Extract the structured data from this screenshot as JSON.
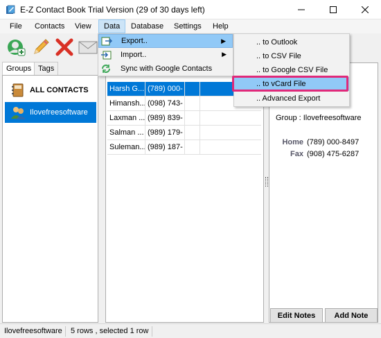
{
  "window": {
    "title": "E-Z Contact Book Trial Version (29 of 30 days left)"
  },
  "menubar": [
    "File",
    "Contacts",
    "View",
    "Data",
    "Database",
    "Settings",
    "Help"
  ],
  "left": {
    "tabs": [
      "Groups",
      "Tags"
    ],
    "groups": [
      "ALL CONTACTS",
      "Ilovefreesoftware"
    ]
  },
  "contacts": [
    {
      "name": "Harsh G...",
      "phone": "(789) 000-"
    },
    {
      "name": "Himansh...",
      "phone": "(098) 743-"
    },
    {
      "name": "Laxman ...",
      "phone": "(989) 839-"
    },
    {
      "name": "Salman ...",
      "phone": "(989) 179-"
    },
    {
      "name": "Suleman...",
      "phone": "(989) 187-"
    }
  ],
  "details": {
    "group_line": "Group : Ilovefreesoftware",
    "home_label": "Home",
    "home_value": "(789) 000-8497",
    "fax_label": "Fax",
    "fax_value": "(908) 475-6287",
    "edit_notes": "Edit Notes",
    "add_note": "Add Note"
  },
  "data_menu": [
    {
      "label": "Export..",
      "arrow": "▶"
    },
    {
      "label": "Import..",
      "arrow": "▶"
    },
    {
      "label": "Sync with Google Contacts"
    }
  ],
  "export_menu": [
    ".. to Outlook",
    ".. to CSV File",
    ".. to Google CSV File",
    ".. to vCard File",
    ".. Advanced Export"
  ],
  "status": {
    "group": "Ilovefreesoftware",
    "rows": "5 rows , selected 1 row"
  },
  "colors": {
    "selection": "#0078d7",
    "menu_highlight": "#91c9f7",
    "annotation": "#e0297a"
  }
}
